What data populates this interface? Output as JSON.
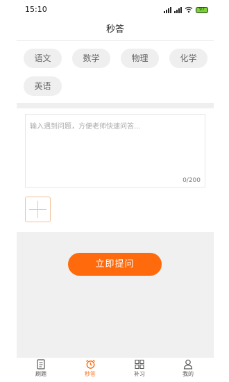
{
  "status_bar": {
    "time": "15:10",
    "battery": "97"
  },
  "navbar": {
    "title": "秒答"
  },
  "subjects": [
    "语文",
    "数学",
    "物理",
    "化学",
    "英语"
  ],
  "question": {
    "placeholder": "输入遇到问题，方便老师快速问答...",
    "counter": "0/200"
  },
  "submit": {
    "label": "立即提问"
  },
  "tabs": [
    {
      "label": "刷题",
      "icon": "document-icon",
      "active": false
    },
    {
      "label": "秒答",
      "icon": "alarm-clock-icon",
      "active": true
    },
    {
      "label": "补习",
      "icon": "grid-icon",
      "active": false
    },
    {
      "label": "我的",
      "icon": "person-icon",
      "active": false
    }
  ],
  "colors": {
    "accent": "#ff6a0d",
    "chip_bg": "#efefef",
    "panel_bg": "#f0f0f0"
  }
}
